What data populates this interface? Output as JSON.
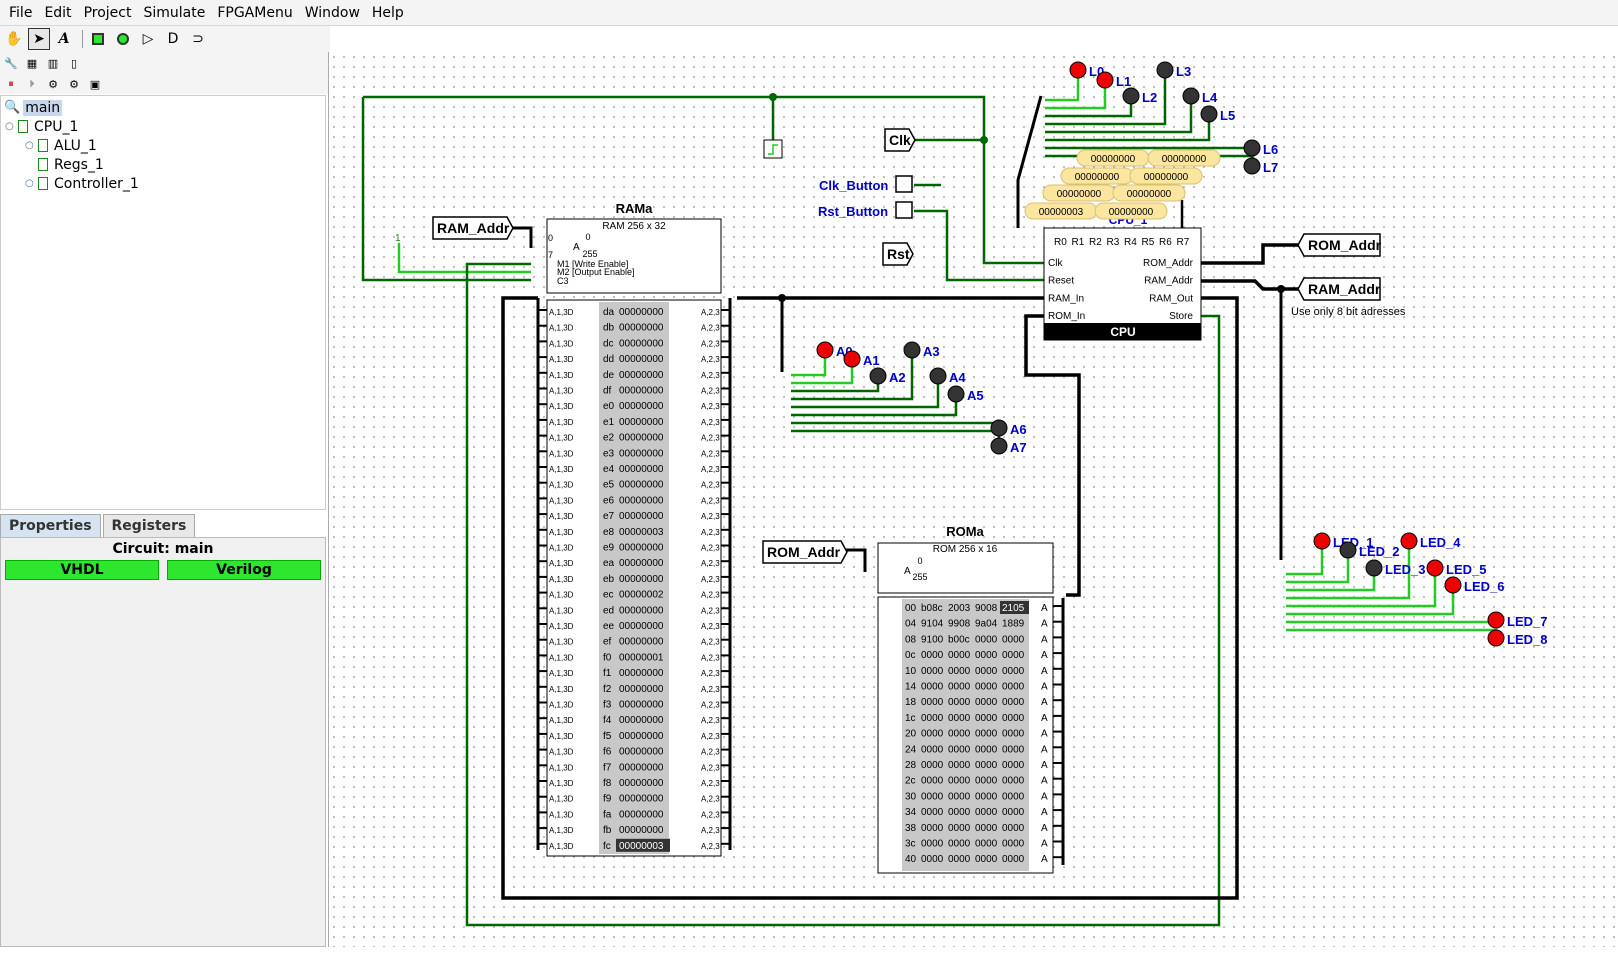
{
  "menu": [
    "File",
    "Edit",
    "Project",
    "Simulate",
    "FPGAMenu",
    "Window",
    "Help"
  ],
  "tree": {
    "root": "main",
    "items": [
      {
        "label": "CPU_1"
      },
      {
        "label": "ALU_1"
      },
      {
        "label": "Regs_1"
      },
      {
        "label": "Controller_1"
      }
    ]
  },
  "tabs": {
    "properties": "Properties",
    "registers": "Registers"
  },
  "props": {
    "circuit": "Circuit: main",
    "vhdl": "VHDL",
    "verilog": "Verilog"
  },
  "canvas": {
    "ram": {
      "title": "RAMa",
      "subtitle": "RAM 256 x 32",
      "range_hi": "0",
      "range_lo": "255",
      "addr_label": "A",
      "pins": [
        "0",
        "7",
        "M1 [Write Enable]",
        "M2 [Output Enable]",
        "C3"
      ],
      "rows": [
        [
          "da",
          "00000000"
        ],
        [
          "db",
          "00000000"
        ],
        [
          "dc",
          "00000000"
        ],
        [
          "dd",
          "00000000"
        ],
        [
          "de",
          "00000000"
        ],
        [
          "df",
          "00000000"
        ],
        [
          "e0",
          "00000000"
        ],
        [
          "e1",
          "00000000"
        ],
        [
          "e2",
          "00000000"
        ],
        [
          "e3",
          "00000000"
        ],
        [
          "e4",
          "00000000"
        ],
        [
          "e5",
          "00000000"
        ],
        [
          "e6",
          "00000000"
        ],
        [
          "e7",
          "00000000"
        ],
        [
          "e8",
          "00000003"
        ],
        [
          "e9",
          "00000000"
        ],
        [
          "ea",
          "00000000"
        ],
        [
          "eb",
          "00000000"
        ],
        [
          "ec",
          "00000002"
        ],
        [
          "ed",
          "00000000"
        ],
        [
          "ee",
          "00000000"
        ],
        [
          "ef",
          "00000000"
        ],
        [
          "f0",
          "00000001"
        ],
        [
          "f1",
          "00000000"
        ],
        [
          "f2",
          "00000000"
        ],
        [
          "f3",
          "00000000"
        ],
        [
          "f4",
          "00000000"
        ],
        [
          "f5",
          "00000000"
        ],
        [
          "f6",
          "00000000"
        ],
        [
          "f7",
          "00000000"
        ],
        [
          "f8",
          "00000000"
        ],
        [
          "f9",
          "00000000"
        ],
        [
          "fa",
          "00000000"
        ],
        [
          "fb",
          "00000000"
        ],
        [
          "fc",
          "00000003"
        ]
      ],
      "left_pin": "A,1,3D",
      "right_pin": "A,2,3"
    },
    "rom": {
      "title": "ROMa",
      "subtitle": "ROM 256 x 16",
      "range_hi": "0",
      "range_lo": "255",
      "addr_label": "A",
      "rows": [
        [
          "00",
          "b08c",
          "2003",
          "9008",
          "2105"
        ],
        [
          "04",
          "9104",
          "9908",
          "9a04",
          "1889"
        ],
        [
          "08",
          "9100",
          "b00c",
          "0000",
          "0000"
        ],
        [
          "0c",
          "0000",
          "0000",
          "0000",
          "0000"
        ],
        [
          "10",
          "0000",
          "0000",
          "0000",
          "0000"
        ],
        [
          "14",
          "0000",
          "0000",
          "0000",
          "0000"
        ],
        [
          "18",
          "0000",
          "0000",
          "0000",
          "0000"
        ],
        [
          "1c",
          "0000",
          "0000",
          "0000",
          "0000"
        ],
        [
          "20",
          "0000",
          "0000",
          "0000",
          "0000"
        ],
        [
          "24",
          "0000",
          "0000",
          "0000",
          "0000"
        ],
        [
          "28",
          "0000",
          "0000",
          "0000",
          "0000"
        ],
        [
          "2c",
          "0000",
          "0000",
          "0000",
          "0000"
        ],
        [
          "30",
          "0000",
          "0000",
          "0000",
          "0000"
        ],
        [
          "34",
          "0000",
          "0000",
          "0000",
          "0000"
        ],
        [
          "38",
          "0000",
          "0000",
          "0000",
          "0000"
        ],
        [
          "3c",
          "0000",
          "0000",
          "0000",
          "0000"
        ],
        [
          "40",
          "0000",
          "0000",
          "0000",
          "0000"
        ]
      ],
      "out_pin": "A"
    },
    "cpu": {
      "label": "CPU",
      "instance": "CPU_1",
      "regs": [
        "R0",
        "R1",
        "R2",
        "R3",
        "R4",
        "R5",
        "R6",
        "R7"
      ],
      "left_ports": [
        "Clk",
        "Reset",
        "RAM_In",
        "ROM_In"
      ],
      "right_ports": [
        "ROM_Addr",
        "RAM_Addr",
        "RAM_Out",
        "Store"
      ],
      "reg_values": [
        "00000000",
        "00000000",
        "00000000",
        "00000000",
        "00000000",
        "00000000",
        "00000003",
        "00000000"
      ]
    },
    "tunnels": {
      "ram_addr_in": "RAM_Addr",
      "rom_addr_in": "ROM_Addr",
      "rom_addr_out": "ROM_Addr",
      "ram_addr_out": "RAM_Addr",
      "clk": "Clk",
      "rst": "Rst"
    },
    "buttons": {
      "clk": "Clk_Button",
      "rst": "Rst_Button"
    },
    "note": "Use only 8 bit adresses",
    "const_one": "1",
    "leds_L": [
      "L0",
      "L1",
      "L2",
      "L3",
      "L4",
      "L5",
      "L6",
      "L7"
    ],
    "leds_A": [
      "A0",
      "A1",
      "A2",
      "A3",
      "A4",
      "A5",
      "A6",
      "A7"
    ],
    "leds_LED": [
      "LED_1",
      "LED_2",
      "LED_3",
      "LED_4",
      "LED_5",
      "LED_6",
      "LED_7",
      "LED_8"
    ],
    "colors": {
      "wire_on": "#22cc22",
      "wire_dark": "#006600",
      "bus": "#000000",
      "led_on": "#ee0000",
      "led_off": "#333333",
      "label": "#0000cc",
      "probe": "#fbe6a0"
    }
  }
}
